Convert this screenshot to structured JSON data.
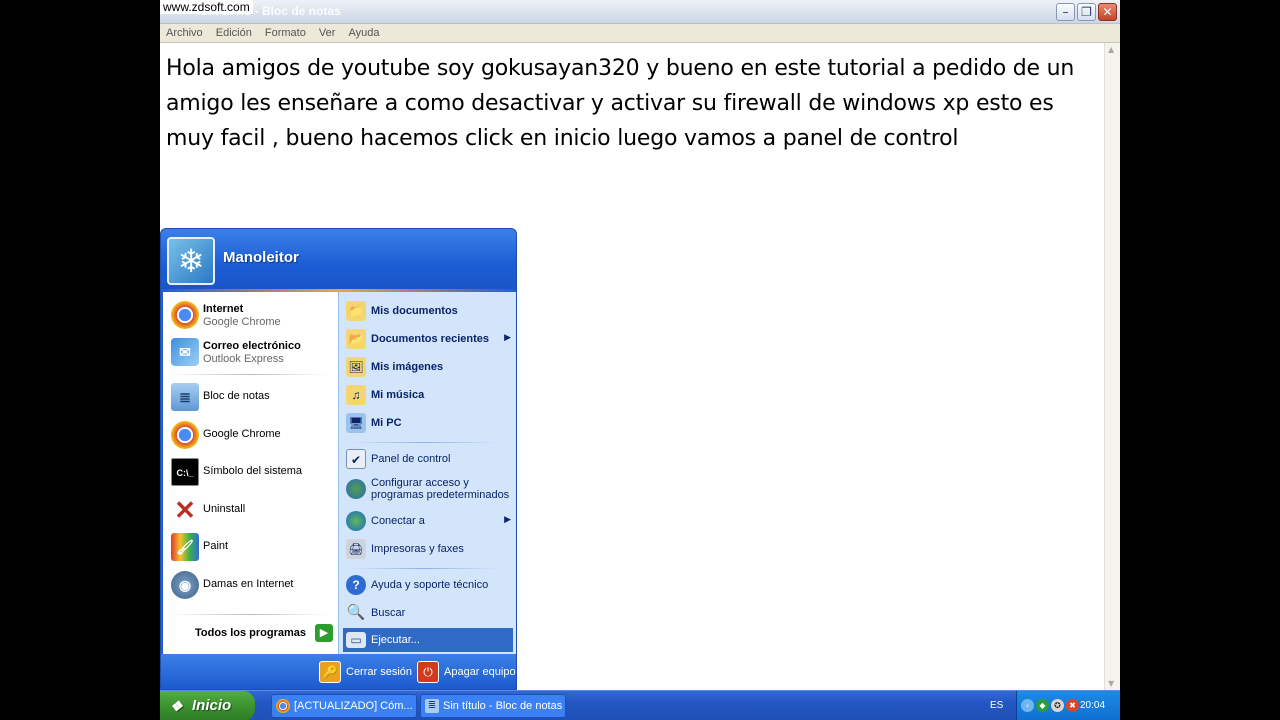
{
  "watermark": "www.zdsoft.com",
  "window": {
    "title": "Sin título - Bloc de notas",
    "min_glyph": "–",
    "max_glyph": "❐",
    "close_glyph": "✕"
  },
  "menubar": {
    "items": [
      "Archivo",
      "Edición",
      "Formato",
      "Ver",
      "Ayuda"
    ]
  },
  "editor": {
    "text": "Hola amigos de youtube soy gokusayan320 y bueno en este tutorial a pedido de un amigo les enseñare a como desactivar y activar su firewall de windows  xp esto es muy facil  , bueno hacemos click en inicio luego vamos a panel de control"
  },
  "start_menu": {
    "user": "Manoleitor",
    "pinned": [
      {
        "title": "Internet",
        "subtitle": "Google Chrome",
        "icon": "chrome-icon"
      },
      {
        "title": "Correo electrónico",
        "subtitle": "Outlook Express",
        "icon": "outlook-icon"
      }
    ],
    "recent": [
      {
        "label": "Bloc de notas",
        "icon": "notepad-icon"
      },
      {
        "label": "Google Chrome",
        "icon": "chrome-icon"
      },
      {
        "label": "Símbolo del sistema",
        "icon": "cmd-icon"
      },
      {
        "label": "Uninstall",
        "icon": "uninstall-icon"
      },
      {
        "label": "Paint",
        "icon": "paint-icon"
      },
      {
        "label": "Damas en Internet",
        "icon": "checkers-icon"
      }
    ],
    "all_programs": "Todos los programas",
    "places": [
      {
        "label": "Mis documentos",
        "icon": "folder-icon"
      },
      {
        "label": "Documentos recientes",
        "icon": "recent-docs-icon"
      },
      {
        "label": "Mis imágenes",
        "icon": "pictures-icon"
      },
      {
        "label": "Mi música",
        "icon": "music-icon"
      },
      {
        "label": "Mi PC",
        "icon": "my-computer-icon"
      }
    ],
    "settings": [
      {
        "label": "Panel de control",
        "icon": "control-panel-icon"
      },
      {
        "label": "Configurar acceso y",
        "label2": "programas predeterminados",
        "icon": "program-access-icon"
      },
      {
        "label": "Conectar a",
        "icon": "network-icon"
      },
      {
        "label": "Impresoras y faxes",
        "icon": "printer-icon"
      }
    ],
    "help": [
      {
        "label": "Ayuda y soporte técnico",
        "icon": "help-icon"
      },
      {
        "label": "Buscar",
        "icon": "search-icon"
      },
      {
        "label": "Ejecutar...",
        "icon": "run-icon"
      }
    ],
    "logoff": "Cerrar sesión",
    "shutdown": "Apagar equipo"
  },
  "taskbar": {
    "start_label": "Inicio",
    "tasks": [
      {
        "label": "[ACTUALIZADO] Cóm...",
        "icon": "chrome-icon"
      },
      {
        "label": "Sin título - Bloc de notas",
        "icon": "notepad-icon"
      }
    ],
    "language": "ES",
    "clock": "20:04"
  }
}
